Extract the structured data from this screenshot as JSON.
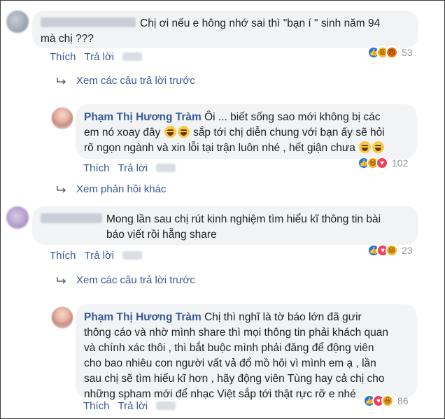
{
  "comments": [
    {
      "text": "Chị ơi nếu e hông nhớ sai thì \"bạn í \" sinh năm 94 mà chị ???",
      "line1": "Chị ơi nếu e hông nhớ sai thì \"bạn í \" sinh năm 94",
      "line2": "mà chị ???",
      "like_label": "Thích",
      "reply_label": "Trả lời",
      "reaction_count": "53",
      "reactions": [
        "like-icon",
        "haha-icon",
        "angry-icon"
      ]
    },
    {
      "name": "Phạm Thị Hương Tràm",
      "line1": "Ôi ... biết sống sao mới không bị các",
      "line2a": "em nó xoay đây",
      "line2b": "sắp tới chị diễn chung với bạn ấy sẽ hỏi",
      "line3": "rõ ngọn ngành và xin lỗi tại trận luôn nhé , hết giận chưa",
      "like_label": "Thích",
      "reply_label": "Trả lời",
      "reaction_count": "102",
      "reactions": [
        "like-icon",
        "haha-icon",
        "love-icon"
      ]
    },
    {
      "line1": "Mong lần sau chị rút kinh nghiệm tìm hiểu kĩ thông tin bài",
      "line2": "báo viết rồi hẵng share",
      "like_label": "Thích",
      "reply_label": "Trả lời",
      "reaction_count": "23",
      "reactions": [
        "like-icon",
        "love-icon",
        "haha-icon"
      ]
    },
    {
      "name": "Phạm Thị Hương Tràm",
      "line1": "Chị thì nghĩ là tờ báo lớn đã gưir",
      "line2": "thông cáo và nhờ mình share thì mọi thông tin phải khách quan",
      "line3": "và chính xác thôi , thì bắt buộc mình phải đăng để động viên",
      "line4": "cho bao nhiêu con người vất vả đổ mồ hôi vì mình em ạ , lần",
      "line5": "sau chị sẽ tìm hiểu kĩ hơn , hãy động viên Tùng hay cả chị cho",
      "line6": "những spham mới để nhạc Việt sắp tới thật rực rỡ e nhé",
      "like_label": "Thích",
      "reply_label": "Trả lời",
      "reaction_count": "86",
      "reactions": [
        "like-icon",
        "love-icon",
        "haha-icon"
      ]
    }
  ],
  "links": {
    "prev_replies_1": "Xem các câu trả lời trước",
    "more_replies": "Xem phản hồi khác",
    "prev_replies_2": "Xem các câu trả lời trước"
  },
  "colors": {
    "link": "#365899",
    "bubble": "#f2f3f5",
    "text": "#1c1e21",
    "meta": "#90949c"
  }
}
